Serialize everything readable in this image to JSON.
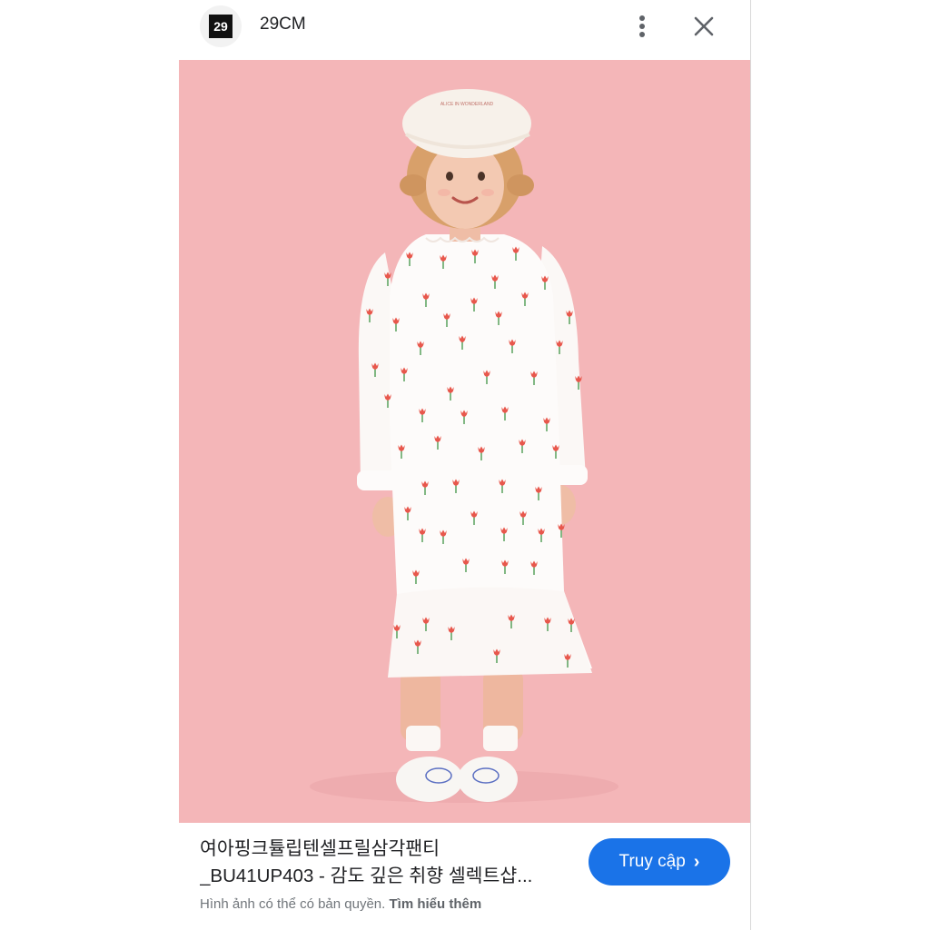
{
  "header": {
    "logo_text": "29",
    "site_name": "29CM",
    "more_icon": "more-vert-icon",
    "close_icon": "close-icon"
  },
  "image": {
    "background_color": "#f4b6b8",
    "beret_text": "ALICE IN WONDERLAND"
  },
  "caption": {
    "title_line1": "여아핑크튤립텐셀프릴삼각팬티",
    "title_line2": "_BU41UP403 - 감도 깊은 취향 셀렉트샵..."
  },
  "copyright": {
    "notice": "Hình ảnh có thể có bản quyền.",
    "learn_more": "Tìm hiểu thêm"
  },
  "visit_button": {
    "label": "Truy cập",
    "chevron": "›",
    "color": "#1a73e8"
  }
}
